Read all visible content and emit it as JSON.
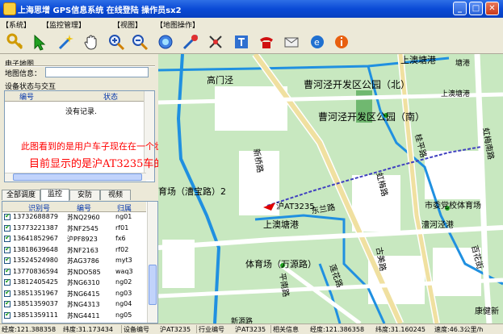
{
  "window": {
    "title": "上海思增 GPS信息系统   在线登陆  操作员sx2",
    "min_label": "_",
    "max_label": "□",
    "close_label": "✕"
  },
  "menu": [
    "【系统】",
    "【监控管理】",
    "【视图】",
    "【地图操作】"
  ],
  "toolbar": {
    "icons": [
      "key-icon",
      "pointer-arrow-icon",
      "magic-wand-icon",
      "hand-pan-icon",
      "zoom-in-icon",
      "zoom-out-icon",
      "globe-target-icon",
      "measure-icon",
      "crosshair-icon",
      "settings-icon",
      "telephone-icon",
      "mail-icon",
      "browser-icon",
      "info-icon"
    ]
  },
  "left": {
    "emap_label": "电子地图",
    "mapinfo_label": "地图信息：",
    "device_section": "设备状态与交互",
    "device_cols": [
      "编号",
      "状态"
    ],
    "no_records": "没有记录."
  },
  "annotation": {
    "line1": "此图看到的是用户车子现在在一个状态",
    "line2": "目前显示的是沪AT3235车的状态",
    "color": "#ff0000"
  },
  "tabs": [
    "全部调度",
    "监控",
    "安防",
    "视频"
  ],
  "vehicle_list": {
    "columns": [
      "识别号",
      "编号",
      "归属"
    ],
    "rows": [
      {
        "id": "13732688879",
        "plate": "苏NQ2960",
        "group": "ng01"
      },
      {
        "id": "13773221387",
        "plate": "苏NF2545",
        "group": "rf01"
      },
      {
        "id": "13641852967",
        "plate": "沪PF8923",
        "group": "fx6"
      },
      {
        "id": "13818639648",
        "plate": "苏NF2163",
        "group": "rf02"
      },
      {
        "id": "13524524980",
        "plate": "苏AG3786",
        "group": "myt3"
      },
      {
        "id": "13770836594",
        "plate": "苏NDO585",
        "group": "waq3"
      },
      {
        "id": "13812405425",
        "plate": "苏NG6310",
        "group": "ng02"
      },
      {
        "id": "13851351967",
        "plate": "苏NG6415",
        "group": "ng03"
      },
      {
        "id": "13851359037",
        "plate": "苏NG4313",
        "group": "ng04"
      },
      {
        "id": "13851359111",
        "plate": "苏NG4411",
        "group": "ng05"
      }
    ]
  },
  "map": {
    "labels": [
      "上澳塘港",
      "上澳塘港",
      "高门泾",
      "曹河泾开发区公园（北）",
      "曹河泾开发区公园（南）",
      "新桥路",
      "虹梅南路",
      "育场（漕宝路）2",
      "桂平路",
      "虹梅路",
      "市委党校体育场",
      "漕河泾港",
      "东兰路",
      "上澳塘港",
      "体育场（万源路）",
      "古美路",
      "平南路",
      "莲花路",
      "百花街",
      "康健新",
      "新源路",
      "塘港"
    ],
    "vehicle_label": "沪AT3235",
    "vehicle_color": "#e00000",
    "track_color": "#4040c0"
  },
  "status": {
    "lon": "经度:121.388358",
    "lat": "纬度:31.173434",
    "dev_label": "设备编号",
    "dev_value": "沪AT3235",
    "trade_label": "行业编号",
    "trade_value": "沪AT3235",
    "related": "相关信息",
    "lon2": "经度:121.386358",
    "lat2": "纬度:31.160245",
    "speed": "速度:46.3公里/h"
  }
}
